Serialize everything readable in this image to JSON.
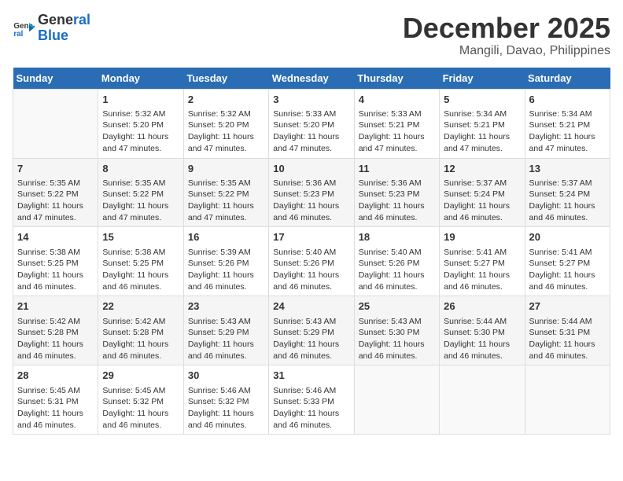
{
  "logo": {
    "line1": "General",
    "line2": "Blue"
  },
  "title": "December 2025",
  "subtitle": "Mangili, Davao, Philippines",
  "days_header": [
    "Sunday",
    "Monday",
    "Tuesday",
    "Wednesday",
    "Thursday",
    "Friday",
    "Saturday"
  ],
  "weeks": [
    [
      {
        "day": "",
        "info": ""
      },
      {
        "day": "1",
        "info": "Sunrise: 5:32 AM\nSunset: 5:20 PM\nDaylight: 11 hours\nand 47 minutes."
      },
      {
        "day": "2",
        "info": "Sunrise: 5:32 AM\nSunset: 5:20 PM\nDaylight: 11 hours\nand 47 minutes."
      },
      {
        "day": "3",
        "info": "Sunrise: 5:33 AM\nSunset: 5:20 PM\nDaylight: 11 hours\nand 47 minutes."
      },
      {
        "day": "4",
        "info": "Sunrise: 5:33 AM\nSunset: 5:21 PM\nDaylight: 11 hours\nand 47 minutes."
      },
      {
        "day": "5",
        "info": "Sunrise: 5:34 AM\nSunset: 5:21 PM\nDaylight: 11 hours\nand 47 minutes."
      },
      {
        "day": "6",
        "info": "Sunrise: 5:34 AM\nSunset: 5:21 PM\nDaylight: 11 hours\nand 47 minutes."
      }
    ],
    [
      {
        "day": "7",
        "info": "Sunrise: 5:35 AM\nSunset: 5:22 PM\nDaylight: 11 hours\nand 47 minutes."
      },
      {
        "day": "8",
        "info": "Sunrise: 5:35 AM\nSunset: 5:22 PM\nDaylight: 11 hours\nand 47 minutes."
      },
      {
        "day": "9",
        "info": "Sunrise: 5:35 AM\nSunset: 5:22 PM\nDaylight: 11 hours\nand 47 minutes."
      },
      {
        "day": "10",
        "info": "Sunrise: 5:36 AM\nSunset: 5:23 PM\nDaylight: 11 hours\nand 46 minutes."
      },
      {
        "day": "11",
        "info": "Sunrise: 5:36 AM\nSunset: 5:23 PM\nDaylight: 11 hours\nand 46 minutes."
      },
      {
        "day": "12",
        "info": "Sunrise: 5:37 AM\nSunset: 5:24 PM\nDaylight: 11 hours\nand 46 minutes."
      },
      {
        "day": "13",
        "info": "Sunrise: 5:37 AM\nSunset: 5:24 PM\nDaylight: 11 hours\nand 46 minutes."
      }
    ],
    [
      {
        "day": "14",
        "info": "Sunrise: 5:38 AM\nSunset: 5:25 PM\nDaylight: 11 hours\nand 46 minutes."
      },
      {
        "day": "15",
        "info": "Sunrise: 5:38 AM\nSunset: 5:25 PM\nDaylight: 11 hours\nand 46 minutes."
      },
      {
        "day": "16",
        "info": "Sunrise: 5:39 AM\nSunset: 5:26 PM\nDaylight: 11 hours\nand 46 minutes."
      },
      {
        "day": "17",
        "info": "Sunrise: 5:40 AM\nSunset: 5:26 PM\nDaylight: 11 hours\nand 46 minutes."
      },
      {
        "day": "18",
        "info": "Sunrise: 5:40 AM\nSunset: 5:26 PM\nDaylight: 11 hours\nand 46 minutes."
      },
      {
        "day": "19",
        "info": "Sunrise: 5:41 AM\nSunset: 5:27 PM\nDaylight: 11 hours\nand 46 minutes."
      },
      {
        "day": "20",
        "info": "Sunrise: 5:41 AM\nSunset: 5:27 PM\nDaylight: 11 hours\nand 46 minutes."
      }
    ],
    [
      {
        "day": "21",
        "info": "Sunrise: 5:42 AM\nSunset: 5:28 PM\nDaylight: 11 hours\nand 46 minutes."
      },
      {
        "day": "22",
        "info": "Sunrise: 5:42 AM\nSunset: 5:28 PM\nDaylight: 11 hours\nand 46 minutes."
      },
      {
        "day": "23",
        "info": "Sunrise: 5:43 AM\nSunset: 5:29 PM\nDaylight: 11 hours\nand 46 minutes."
      },
      {
        "day": "24",
        "info": "Sunrise: 5:43 AM\nSunset: 5:29 PM\nDaylight: 11 hours\nand 46 minutes."
      },
      {
        "day": "25",
        "info": "Sunrise: 5:43 AM\nSunset: 5:30 PM\nDaylight: 11 hours\nand 46 minutes."
      },
      {
        "day": "26",
        "info": "Sunrise: 5:44 AM\nSunset: 5:30 PM\nDaylight: 11 hours\nand 46 minutes."
      },
      {
        "day": "27",
        "info": "Sunrise: 5:44 AM\nSunset: 5:31 PM\nDaylight: 11 hours\nand 46 minutes."
      }
    ],
    [
      {
        "day": "28",
        "info": "Sunrise: 5:45 AM\nSunset: 5:31 PM\nDaylight: 11 hours\nand 46 minutes."
      },
      {
        "day": "29",
        "info": "Sunrise: 5:45 AM\nSunset: 5:32 PM\nDaylight: 11 hours\nand 46 minutes."
      },
      {
        "day": "30",
        "info": "Sunrise: 5:46 AM\nSunset: 5:32 PM\nDaylight: 11 hours\nand 46 minutes."
      },
      {
        "day": "31",
        "info": "Sunrise: 5:46 AM\nSunset: 5:33 PM\nDaylight: 11 hours\nand 46 minutes."
      },
      {
        "day": "",
        "info": ""
      },
      {
        "day": "",
        "info": ""
      },
      {
        "day": "",
        "info": ""
      }
    ]
  ]
}
